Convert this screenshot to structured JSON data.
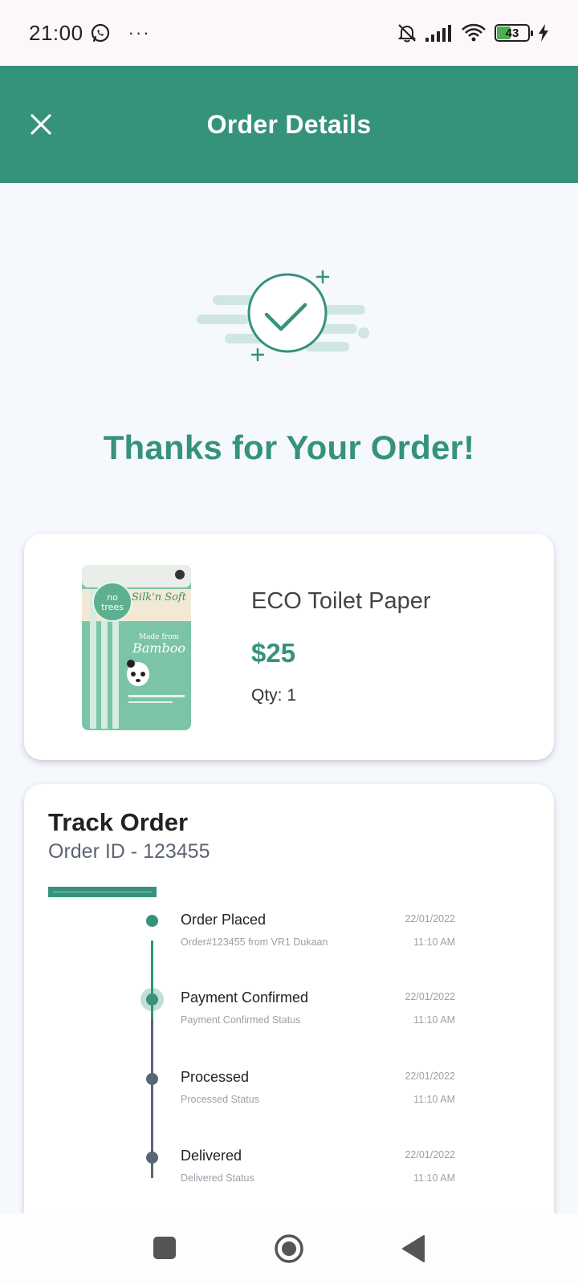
{
  "status_bar": {
    "time": "21:00",
    "more": "···",
    "battery": "43"
  },
  "app_bar": {
    "title": "Order Details"
  },
  "hero": {
    "message": "Thanks for Your Order!"
  },
  "product": {
    "name": "ECO Toilet Paper",
    "price": "$25",
    "qty": "Qty: 1",
    "package": {
      "brand_line1": "no",
      "brand_line2": "trees",
      "title": "Silk'n Soft",
      "made_from": "Made from",
      "material": "Bamboo"
    }
  },
  "tracking": {
    "title": "Track Order",
    "order_id": "Order ID - 123455",
    "steps": [
      {
        "title": "Order Placed",
        "subtitle": "Order#123455 from VR1 Dukaan",
        "date": "22/01/2022",
        "time": "11:10 AM",
        "status": "done"
      },
      {
        "title": "Payment Confirmed",
        "subtitle": "Payment Confirmed Status",
        "date": "22/01/2022",
        "time": "11:10 AM",
        "status": "current"
      },
      {
        "title": "Processed",
        "subtitle": "Processed Status",
        "date": "22/01/2022",
        "time": "11:10 AM",
        "status": "pending"
      },
      {
        "title": "Delivered",
        "subtitle": "Delivered Status",
        "date": "22/01/2022",
        "time": "11:10 AM",
        "status": "pending"
      }
    ]
  },
  "colors": {
    "primary": "#35927b",
    "pending": "#5a6677",
    "background": "#f5f8fc"
  },
  "icons": {
    "close": "close-icon",
    "whatsapp": "whatsapp-icon",
    "mute": "bell-off-icon",
    "signal": "signal-icon",
    "wifi": "wifi-icon",
    "charging": "bolt-icon",
    "check": "check-circle-icon",
    "nav_recent": "square-icon",
    "nav_home": "circle-home-icon",
    "nav_back": "triangle-back-icon"
  }
}
